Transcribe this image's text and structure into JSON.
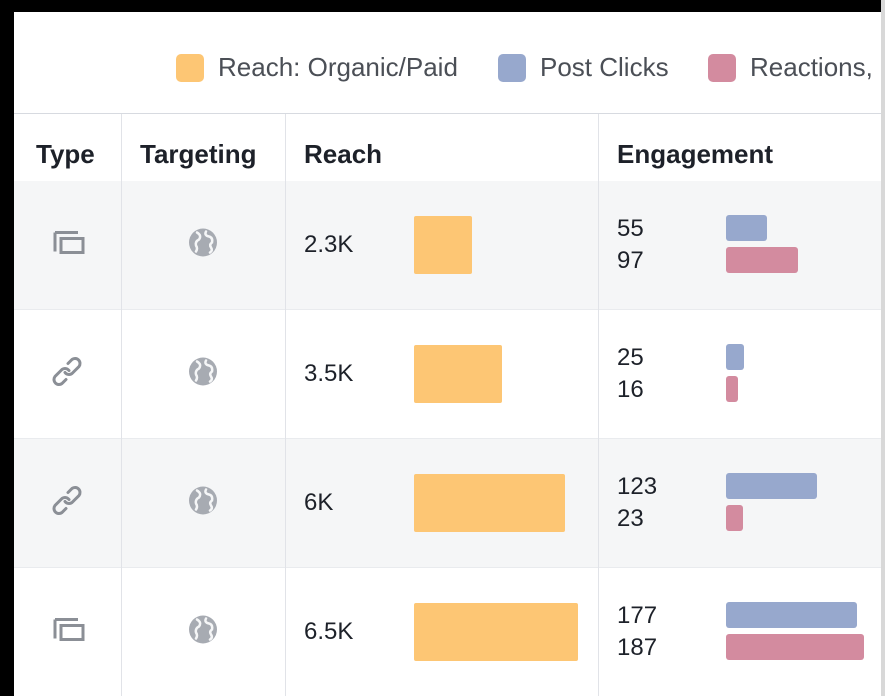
{
  "colors": {
    "reach": "#fdc674",
    "post_clicks": "#97a8cd",
    "reactions": "#d38b9f",
    "globe": "#a7abb2",
    "type_icon": "#8b8f96"
  },
  "legend": [
    {
      "label": "Reach: Organic/Paid",
      "color": "#fdc674"
    },
    {
      "label": "Post Clicks",
      "color": "#97a8cd"
    },
    {
      "label": "Reactions, (",
      "color": "#d38b9f"
    }
  ],
  "columns": {
    "type": "Type",
    "targeting": "Targeting",
    "reach": "Reach",
    "engagement": "Engagement"
  },
  "rows": [
    {
      "type_icon": "status-icon",
      "targeting_icon": "globe-icon",
      "reach": "2.3K",
      "reach_value": 2300,
      "post_clicks": "55",
      "post_clicks_value": 55,
      "reactions": "97",
      "reactions_value": 97
    },
    {
      "type_icon": "link-icon",
      "targeting_icon": "globe-icon",
      "reach": "3.5K",
      "reach_value": 3500,
      "post_clicks": "25",
      "post_clicks_value": 25,
      "reactions": "16",
      "reactions_value": 16
    },
    {
      "type_icon": "link-icon",
      "targeting_icon": "globe-icon",
      "reach": "6K",
      "reach_value": 6000,
      "post_clicks": "123",
      "post_clicks_value": 123,
      "reactions": "23",
      "reactions_value": 23
    },
    {
      "type_icon": "status-icon",
      "targeting_icon": "globe-icon",
      "reach": "6.5K",
      "reach_value": 6500,
      "post_clicks": "177",
      "post_clicks_value": 177,
      "reactions": "187",
      "reactions_value": 187
    }
  ]
}
